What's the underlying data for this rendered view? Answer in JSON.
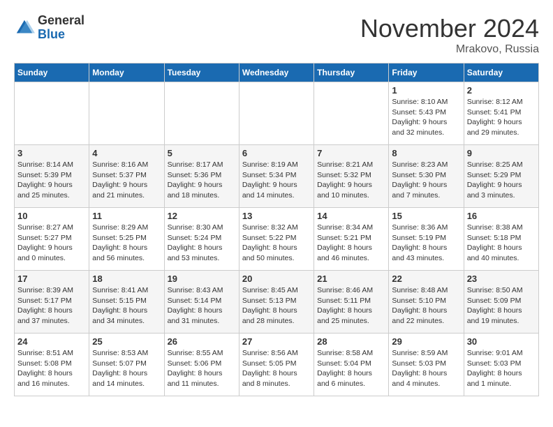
{
  "header": {
    "logo_general": "General",
    "logo_blue": "Blue",
    "month_title": "November 2024",
    "location": "Mrakovo, Russia"
  },
  "days_of_week": [
    "Sunday",
    "Monday",
    "Tuesday",
    "Wednesday",
    "Thursday",
    "Friday",
    "Saturday"
  ],
  "weeks": [
    [
      {
        "day": "",
        "info": ""
      },
      {
        "day": "",
        "info": ""
      },
      {
        "day": "",
        "info": ""
      },
      {
        "day": "",
        "info": ""
      },
      {
        "day": "",
        "info": ""
      },
      {
        "day": "1",
        "info": "Sunrise: 8:10 AM\nSunset: 5:43 PM\nDaylight: 9 hours and 32 minutes."
      },
      {
        "day": "2",
        "info": "Sunrise: 8:12 AM\nSunset: 5:41 PM\nDaylight: 9 hours and 29 minutes."
      }
    ],
    [
      {
        "day": "3",
        "info": "Sunrise: 8:14 AM\nSunset: 5:39 PM\nDaylight: 9 hours and 25 minutes."
      },
      {
        "day": "4",
        "info": "Sunrise: 8:16 AM\nSunset: 5:37 PM\nDaylight: 9 hours and 21 minutes."
      },
      {
        "day": "5",
        "info": "Sunrise: 8:17 AM\nSunset: 5:36 PM\nDaylight: 9 hours and 18 minutes."
      },
      {
        "day": "6",
        "info": "Sunrise: 8:19 AM\nSunset: 5:34 PM\nDaylight: 9 hours and 14 minutes."
      },
      {
        "day": "7",
        "info": "Sunrise: 8:21 AM\nSunset: 5:32 PM\nDaylight: 9 hours and 10 minutes."
      },
      {
        "day": "8",
        "info": "Sunrise: 8:23 AM\nSunset: 5:30 PM\nDaylight: 9 hours and 7 minutes."
      },
      {
        "day": "9",
        "info": "Sunrise: 8:25 AM\nSunset: 5:29 PM\nDaylight: 9 hours and 3 minutes."
      }
    ],
    [
      {
        "day": "10",
        "info": "Sunrise: 8:27 AM\nSunset: 5:27 PM\nDaylight: 9 hours and 0 minutes."
      },
      {
        "day": "11",
        "info": "Sunrise: 8:29 AM\nSunset: 5:25 PM\nDaylight: 8 hours and 56 minutes."
      },
      {
        "day": "12",
        "info": "Sunrise: 8:30 AM\nSunset: 5:24 PM\nDaylight: 8 hours and 53 minutes."
      },
      {
        "day": "13",
        "info": "Sunrise: 8:32 AM\nSunset: 5:22 PM\nDaylight: 8 hours and 50 minutes."
      },
      {
        "day": "14",
        "info": "Sunrise: 8:34 AM\nSunset: 5:21 PM\nDaylight: 8 hours and 46 minutes."
      },
      {
        "day": "15",
        "info": "Sunrise: 8:36 AM\nSunset: 5:19 PM\nDaylight: 8 hours and 43 minutes."
      },
      {
        "day": "16",
        "info": "Sunrise: 8:38 AM\nSunset: 5:18 PM\nDaylight: 8 hours and 40 minutes."
      }
    ],
    [
      {
        "day": "17",
        "info": "Sunrise: 8:39 AM\nSunset: 5:17 PM\nDaylight: 8 hours and 37 minutes."
      },
      {
        "day": "18",
        "info": "Sunrise: 8:41 AM\nSunset: 5:15 PM\nDaylight: 8 hours and 34 minutes."
      },
      {
        "day": "19",
        "info": "Sunrise: 8:43 AM\nSunset: 5:14 PM\nDaylight: 8 hours and 31 minutes."
      },
      {
        "day": "20",
        "info": "Sunrise: 8:45 AM\nSunset: 5:13 PM\nDaylight: 8 hours and 28 minutes."
      },
      {
        "day": "21",
        "info": "Sunrise: 8:46 AM\nSunset: 5:11 PM\nDaylight: 8 hours and 25 minutes."
      },
      {
        "day": "22",
        "info": "Sunrise: 8:48 AM\nSunset: 5:10 PM\nDaylight: 8 hours and 22 minutes."
      },
      {
        "day": "23",
        "info": "Sunrise: 8:50 AM\nSunset: 5:09 PM\nDaylight: 8 hours and 19 minutes."
      }
    ],
    [
      {
        "day": "24",
        "info": "Sunrise: 8:51 AM\nSunset: 5:08 PM\nDaylight: 8 hours and 16 minutes."
      },
      {
        "day": "25",
        "info": "Sunrise: 8:53 AM\nSunset: 5:07 PM\nDaylight: 8 hours and 14 minutes."
      },
      {
        "day": "26",
        "info": "Sunrise: 8:55 AM\nSunset: 5:06 PM\nDaylight: 8 hours and 11 minutes."
      },
      {
        "day": "27",
        "info": "Sunrise: 8:56 AM\nSunset: 5:05 PM\nDaylight: 8 hours and 8 minutes."
      },
      {
        "day": "28",
        "info": "Sunrise: 8:58 AM\nSunset: 5:04 PM\nDaylight: 8 hours and 6 minutes."
      },
      {
        "day": "29",
        "info": "Sunrise: 8:59 AM\nSunset: 5:03 PM\nDaylight: 8 hours and 4 minutes."
      },
      {
        "day": "30",
        "info": "Sunrise: 9:01 AM\nSunset: 5:03 PM\nDaylight: 8 hours and 1 minute."
      }
    ]
  ]
}
